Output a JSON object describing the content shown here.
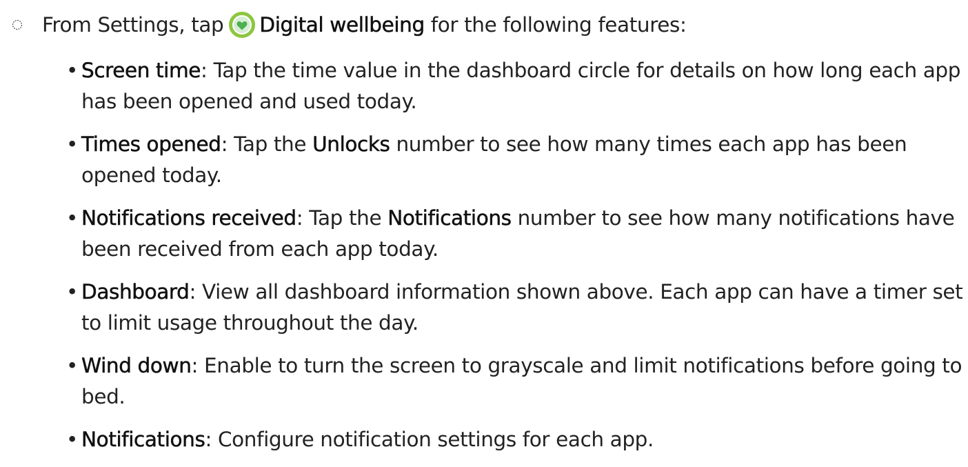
{
  "intro": {
    "prefix": "From Settings, tap",
    "app_name": "Digital wellbeing",
    "suffix": "for the following features:",
    "icon_color": "#8cc63f"
  },
  "bullets": [
    {
      "term": "Screen time",
      "text": ": Tap the time value in the dashboard circle for details on how long each app has been opened and used today."
    },
    {
      "term": "Times opened",
      "text_1": ": Tap the ",
      "ui_term": "Unlocks",
      "text_2": " number to see how many times each app has been opened today."
    },
    {
      "term": "Notifications received",
      "text_1": ": Tap the ",
      "ui_term": "Notifications",
      "text_2": " number to see how many notifications have been received from each app today."
    },
    {
      "term": "Dashboard",
      "text": ": View all dashboard information shown above. Each app can have a timer set to limit usage throughout the day."
    },
    {
      "term": "Wind down",
      "text": ": Enable to turn the screen to grayscale and limit notifications before going to bed."
    },
    {
      "term": "Notifications",
      "text": ": Configure notification settings for each app."
    }
  ]
}
